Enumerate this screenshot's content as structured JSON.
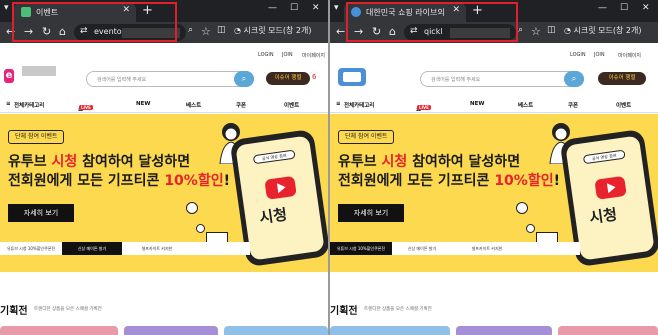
{
  "colors": {
    "accent_red": "#e8232d",
    "banner_yellow": "#fcd94e",
    "search_blue": "#5aa7d8",
    "highlight_box": "#e0202a"
  },
  "left": {
    "tab_title": "이벤트",
    "url": "evento",
    "incognito": "시크릿 모드(창 2개)",
    "top_links": [
      "LOGIN",
      "JOIN",
      "마이페이지"
    ],
    "logo_text": "e",
    "search_placeholder": "검색어를 입력해 주세요",
    "event_pill": "이슈어 행렬",
    "nav": {
      "category": "전체카테고리",
      "live": "쇼핑",
      "live_badge": "LIVE",
      "new": "NEW",
      "best": "베스트",
      "coupon": "쿠폰",
      "event": "이벤트"
    },
    "banner": {
      "tag": "단체 참여 이벤트",
      "line1_a": "유투브 ",
      "line1_red": "시청",
      "line1_b": " 참여하여 달성하면",
      "line2_a": "전회원에게 모든 기프티콘 ",
      "line2_red": "10%할인",
      "line2_b": "!",
      "detail": "자세히 보기",
      "phone_pill": "공식 영상 참여",
      "phone_word": "시청",
      "subtabs": [
        "유튜브 시청 10%할인쿠폰전",
        "신상 메이튼 발기",
        "셀프카이트 커지한"
      ]
    },
    "section": {
      "title": "기획전",
      "sub": "트렌디한 상품을 모은 스페셜 기획전"
    }
  },
  "right": {
    "tab_title": "대한민국 쇼핑 라이브의 중심...",
    "url": "qickl",
    "incognito": "시크릿 모드(창 2개)",
    "top_links": [
      "LOGIN",
      "JOIN",
      "마이페이지"
    ],
    "search_placeholder": "검색어를 입력해 주세요",
    "event_pill": "이슈어 행렬",
    "nav": {
      "category": "전체카테고리",
      "live": "쇼핑",
      "live_badge": "LIVE",
      "new": "NEW",
      "best": "베스트",
      "coupon": "쿠폰",
      "event": "이벤트"
    },
    "banner": {
      "tag": "단체 참여 이벤트",
      "line1_a": "유투브 ",
      "line1_red": "시청",
      "line1_b": " 참여하여 달성하면",
      "line2_a": "전회원에게 모든 기프티콘 ",
      "line2_red": "10%할인",
      "line2_b": "!",
      "detail": "자세히 보기",
      "phone_pill": "공식 영상 참여",
      "phone_word": "시청",
      "subtabs": [
        "유튜브 시청 10%할인쿠폰전",
        "신상 메이튼 발기",
        "셀프카이트 커지한"
      ]
    },
    "section": {
      "title": "기획전",
      "sub": "트렌디한 상품을 모은 스페셜 기획전"
    }
  }
}
